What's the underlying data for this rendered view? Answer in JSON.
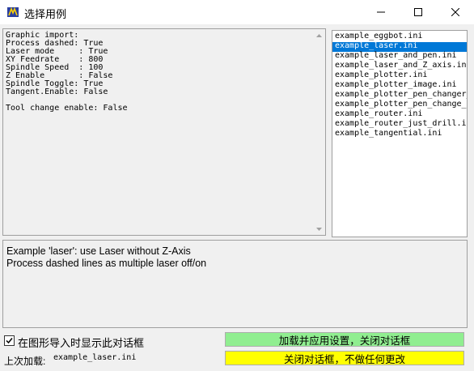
{
  "window": {
    "title": "选择用例",
    "icon": "app-icon"
  },
  "config_text": "Graphic import:\nProcess dashed: True\nLaser mode     : True\nXY Feedrate    : 800\nSpindle Speed  : 100\nZ Enable       : False\nSpindle Toggle: True\nTangent.Enable: False\n\nTool change enable: False",
  "example_list": {
    "items": [
      "example_eggbot.ini",
      "example_laser.ini",
      "example_laser_and_pen.ini",
      "example_laser_and_Z_axis.ini",
      "example_plotter.ini",
      "example_plotter_image.ini",
      "example_plotter_pen_changer_",
      "example_plotter_pen_change_n",
      "example_router.ini",
      "example_router_just_drill.ini",
      "example_tangential.ini"
    ],
    "selected_index": 1
  },
  "description": {
    "lines": [
      "Example 'laser': use Laser without Z-Axis",
      "Process dashed lines as multiple laser off/on"
    ]
  },
  "footer": {
    "checkbox_label": "在图形导入时显示此对话框",
    "checkbox_checked": true,
    "last_loaded_label": "上次加载:",
    "last_loaded_value": "example_laser.ini",
    "apply_button": "加载并应用设置，关闭对话框",
    "close_button": "关闭对话框，不做任何更改"
  },
  "colors": {
    "apply_button_bg": "#90ee90",
    "close_button_bg": "#ffff00",
    "selection_bg": "#0078d7"
  }
}
